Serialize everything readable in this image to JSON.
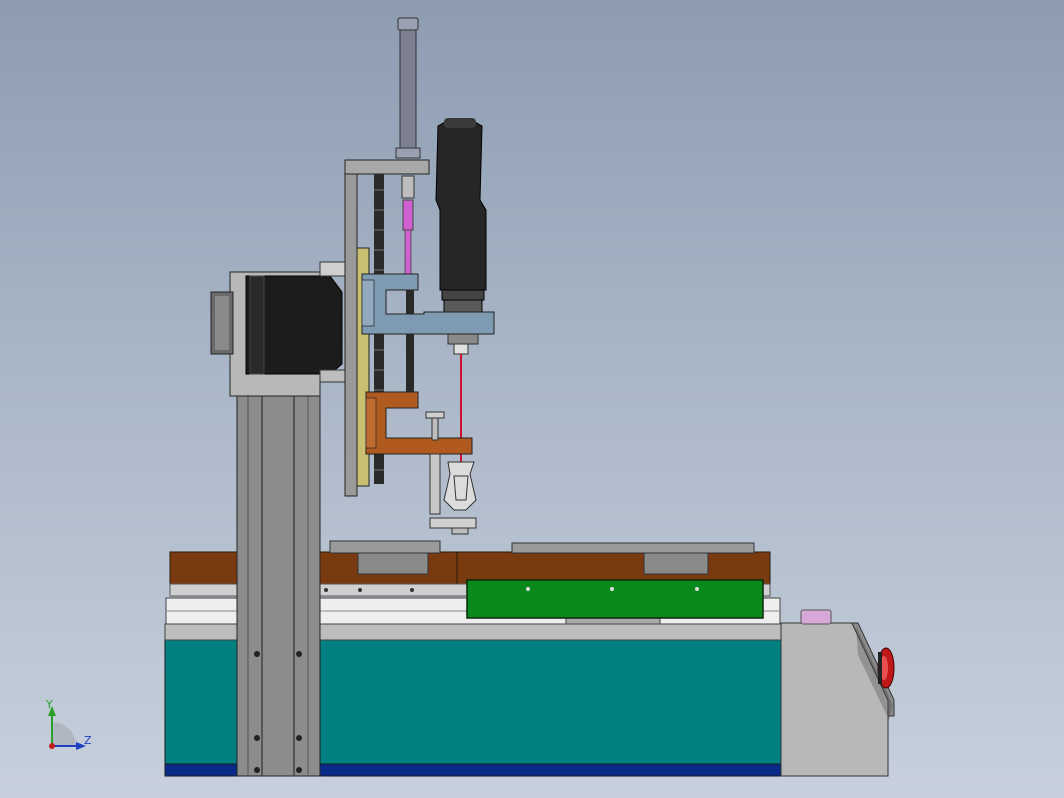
{
  "viewport": {
    "background_top": "#8d9cb2",
    "background_bottom": "#c7d0dc"
  },
  "triad": {
    "y_label": "Y",
    "z_label": "Z",
    "y_color": "#2aa02a",
    "z_color": "#2040c0",
    "x_color": "#c02020"
  },
  "colors": {
    "base_teal": "#008080",
    "navy_strip": "#0a2a8a",
    "brown_plate": "#7a3a10",
    "green_panel": "#0a8a1a",
    "blue_bracket": "#7f9ab3",
    "orange_bracket": "#b05a20",
    "magenta_rod": "#d060d0",
    "laser_line": "#d01030",
    "estop_red": "#c01818",
    "console_grey": "#b8b8b8",
    "screwdriver_black": "#262626"
  }
}
